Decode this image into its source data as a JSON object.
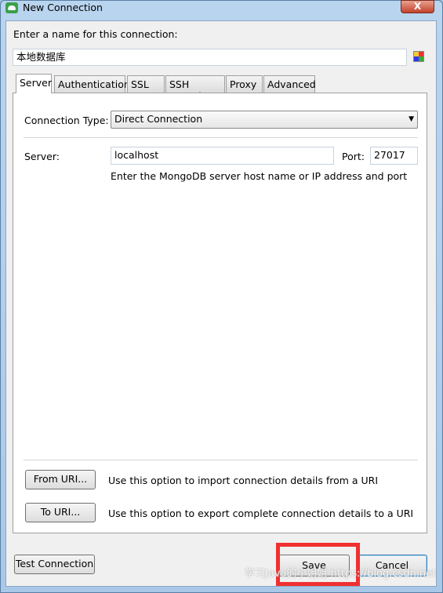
{
  "window": {
    "title": "New Connection",
    "close": "X"
  },
  "name_label": "Enter a name for this connection:",
  "name_value": "本地数据库",
  "tabs": [
    "Server",
    "Authentication",
    "SSL",
    "SSH Tunnel",
    "Proxy",
    "Advanced"
  ],
  "active_tab": "Server",
  "server": {
    "connection_type_label": "Connection Type:",
    "connection_type_value": "Direct Connection",
    "server_label": "Server:",
    "server_value": "localhost",
    "port_label": "Port:",
    "port_value": "27017",
    "help": "Enter the MongoDB server host name or IP address and port"
  },
  "uri": {
    "from_button": "From URI...",
    "from_desc": "Use this option to import connection details from a URI",
    "to_button": "To URI...",
    "to_desc": "Use this option to export complete connection details to a URI"
  },
  "footer": {
    "test": "Test Connection",
    "save": "Save",
    "cancel": "Cancel"
  },
  "highlight_color": "#ff2a2a",
  "watermark": "学习Java的小姐姐 https://blog.csdn.net"
}
